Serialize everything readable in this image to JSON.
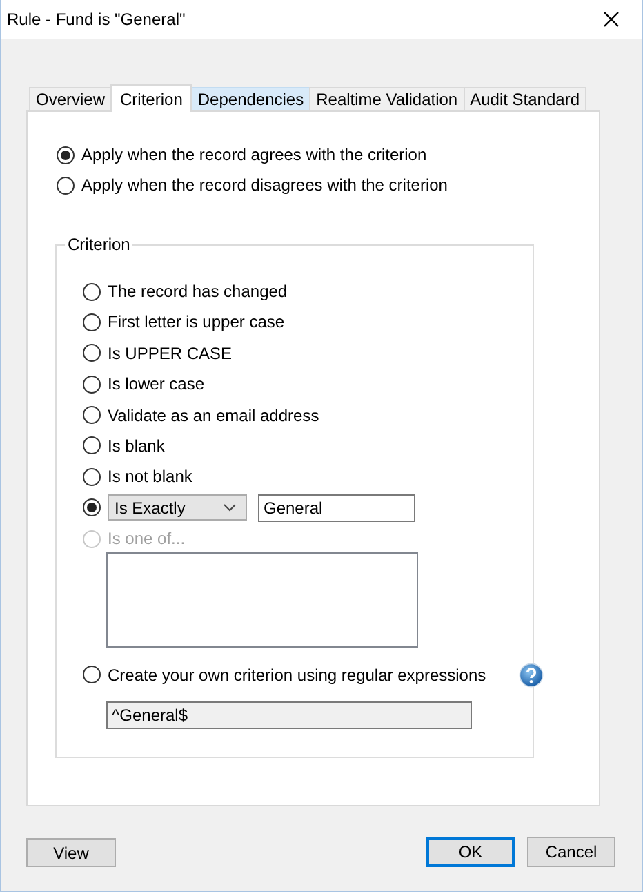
{
  "window": {
    "title": "Rule - Fund is \"General\""
  },
  "tabs": [
    {
      "label": "Overview",
      "selected": false,
      "hovered": false
    },
    {
      "label": "Criterion",
      "selected": true,
      "hovered": false
    },
    {
      "label": "Dependencies",
      "selected": false,
      "hovered": true
    },
    {
      "label": "Realtime Validation",
      "selected": false,
      "hovered": false
    },
    {
      "label": "Audit Standard",
      "selected": false,
      "hovered": false
    }
  ],
  "apply_modes": [
    {
      "label": "Apply when the record agrees with the criterion",
      "selected": true
    },
    {
      "label": "Apply when the record disagrees with the criterion",
      "selected": false
    }
  ],
  "criterion": {
    "title": "Criterion",
    "options": [
      {
        "kind": "radio",
        "label": "The record has changed",
        "selected": false,
        "disabled": false
      },
      {
        "kind": "radio",
        "label": "First letter is upper case",
        "selected": false,
        "disabled": false
      },
      {
        "kind": "radio",
        "label": "Is UPPER CASE",
        "selected": false,
        "disabled": false
      },
      {
        "kind": "radio",
        "label": "Is lower case",
        "selected": false,
        "disabled": false
      },
      {
        "kind": "radio",
        "label": "Validate as an email address",
        "selected": false,
        "disabled": false
      },
      {
        "kind": "radio",
        "label": "Is blank",
        "selected": false,
        "disabled": false
      },
      {
        "kind": "radio",
        "label": "Is not blank",
        "selected": false,
        "disabled": false
      },
      {
        "kind": "compare",
        "operator": "Is Exactly",
        "value": "General",
        "selected": true,
        "disabled": false
      },
      {
        "kind": "list",
        "label": "Is one of...",
        "selected": false,
        "disabled": true
      },
      {
        "kind": "regex",
        "label": "Create your own criterion using regular expressions",
        "value": "^General$",
        "selected": false,
        "disabled": false
      }
    ]
  },
  "left_buttons": [
    {
      "label": "View",
      "default": false
    }
  ],
  "right_buttons": [
    {
      "label": "OK",
      "default": true
    },
    {
      "label": "Cancel",
      "default": false
    }
  ]
}
